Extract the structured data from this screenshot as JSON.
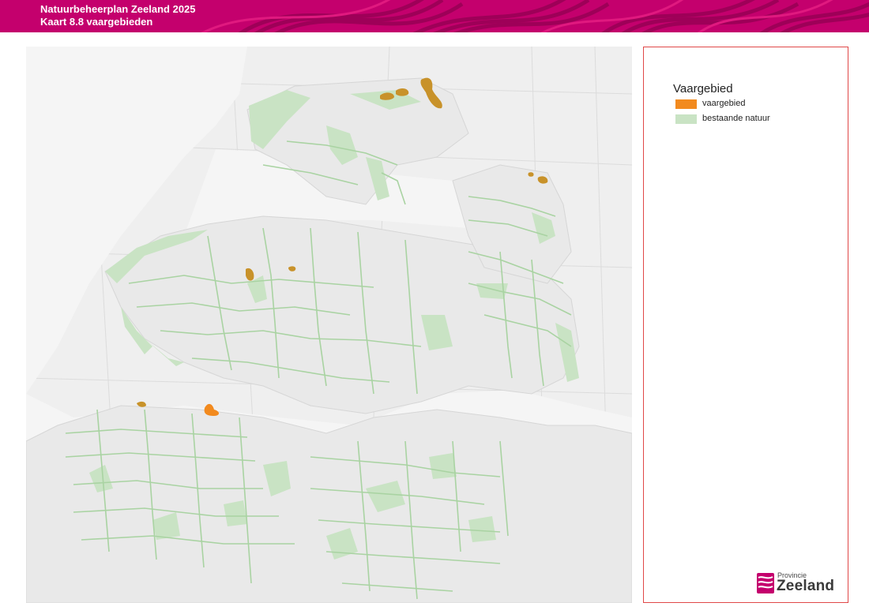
{
  "header": {
    "title": "Natuurbeheerplan Zeeland 2025",
    "subtitle": "Kaart 8.8 vaargebieden",
    "color": "#c4006d"
  },
  "legend": {
    "title": "Vaargebied",
    "items": [
      {
        "label": "vaargebied",
        "color": "#f28a1e"
      },
      {
        "label": "bestaande natuur",
        "color": "#c9e3c4"
      }
    ]
  },
  "logo": {
    "line1": "Provincie",
    "line2": "Zeeland",
    "color": "#c4006d"
  },
  "map": {
    "background_color": "#efefef",
    "land_color": "#e8e8e8",
    "water_color": "#f4f4f4",
    "nature_color": "#c9e3c4",
    "nature_line_color": "#a9d3a2",
    "vaargebied_color": "#f28a1e",
    "vaargebied_overlap_color": "#c8922a"
  }
}
